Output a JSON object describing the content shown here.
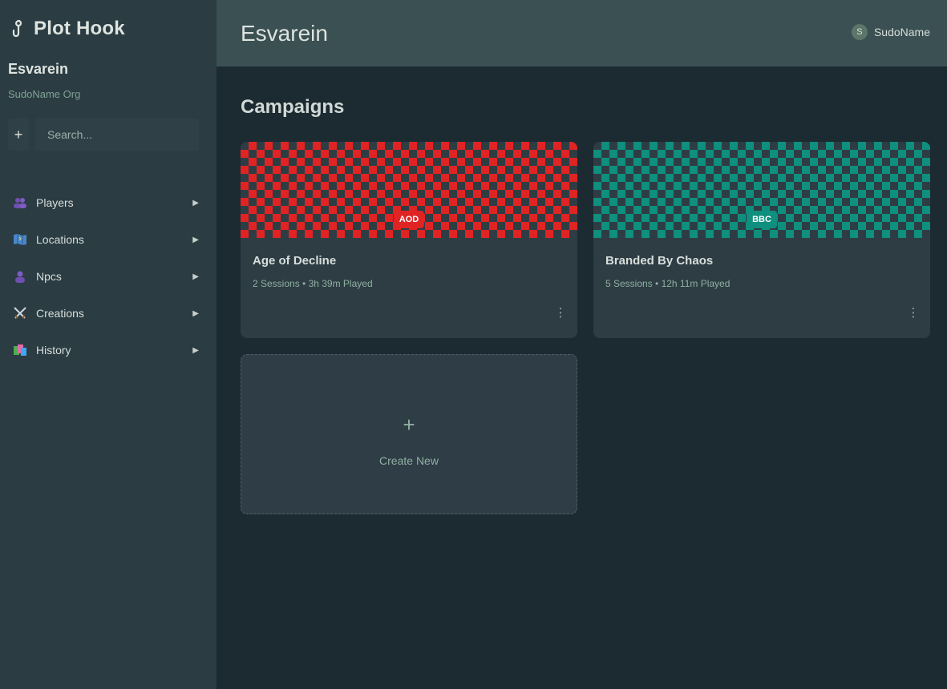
{
  "app": {
    "name": "Plot Hook",
    "icon": "hook-icon"
  },
  "sidebar": {
    "world_name": "Esvarein",
    "org_name": "SudoName Org",
    "add_label": "+",
    "search": {
      "placeholder": "Search...",
      "value": ""
    },
    "nav_items": [
      {
        "label": "Players",
        "icon": "players-icon"
      },
      {
        "label": "Locations",
        "icon": "map-icon"
      },
      {
        "label": "Npcs",
        "icon": "npc-icon"
      },
      {
        "label": "Creations",
        "icon": "swords-icon"
      },
      {
        "label": "History",
        "icon": "history-icon"
      }
    ]
  },
  "header": {
    "title": "Esvarein",
    "user": {
      "initial": "S",
      "name": "SudoName"
    }
  },
  "main": {
    "section_title": "Campaigns",
    "campaigns": [
      {
        "badge": "AOD",
        "name": "Age of Decline",
        "meta": "2 Sessions • 3h 39m Played",
        "color": "#e02424",
        "more": "⋮"
      },
      {
        "badge": "BBC",
        "name": "Branded By Chaos",
        "meta": "5 Sessions • 12h 11m Played",
        "color": "#0f8f7e",
        "more": "⋮"
      }
    ],
    "create": {
      "icon": "+",
      "label": "Create New"
    }
  },
  "colors": {
    "sidebar_bg": "#2b3c42",
    "topbar_bg": "#3a5052",
    "page_bg": "#1c2a32",
    "accent_text": "#8fb0a2"
  }
}
